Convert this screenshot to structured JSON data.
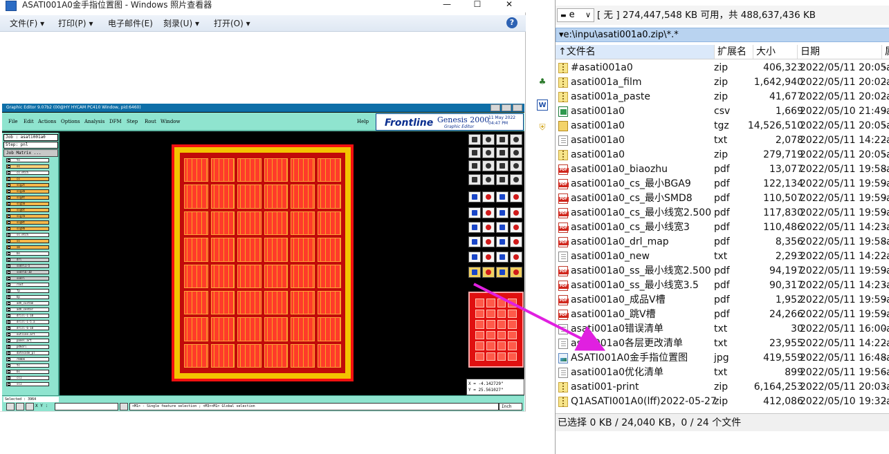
{
  "photo_viewer": {
    "title": "ASATI001A0金手指位置图 - Windows 照片查看器",
    "window_controls": {
      "minimize": "—",
      "maximize": "☐",
      "close": "✕"
    },
    "menu": [
      "文件(F)",
      "打印(P)",
      "电子邮件(E)",
      "刻录(U)",
      "打开(O)"
    ],
    "help_glyph": "?"
  },
  "genesis": {
    "title_bar": "Graphic Editor 9.07b2 (00@HY HYCAM PC410 Window, pid:6460)",
    "menu": [
      "File",
      "Edit",
      "Actions",
      "Options",
      "Analysis",
      "DFM",
      "Step",
      "Rout",
      "Window"
    ],
    "help": "Help",
    "logo_text": "Frontline",
    "product": "Genesis 2000",
    "subtitle": "Graphic Editor",
    "date": "11 May 2022",
    "time": "04:47 PM",
    "job": "Job : asati001a0",
    "step": "Step: pnl",
    "job_matrix": "Job Matrix ...",
    "layers": [
      {
        "name": "to",
        "color": "#ffffff"
      },
      {
        "name": "ss",
        "color": "#ffd37a"
      },
      {
        "name": "cs.etch",
        "color": "#ffffff"
      },
      {
        "name": "cs",
        "color": "#f5b84a"
      },
      {
        "name": "sig2t",
        "color": "#f5b84a"
      },
      {
        "name": "sig3b",
        "color": "#f5b84a"
      },
      {
        "name": "sig4t",
        "color": "#f5b84a"
      },
      {
        "name": "sig5b",
        "color": "#f5b84a"
      },
      {
        "name": "sig6t",
        "color": "#f5b84a"
      },
      {
        "name": "sig7b",
        "color": "#f5b84a"
      },
      {
        "name": "sig8t",
        "color": "#f5b84a"
      },
      {
        "name": "sig9b",
        "color": "#f5b84a"
      },
      {
        "name": "ss.etch",
        "color": "#ffffff"
      },
      {
        "name": "ss",
        "color": "#f5b84a"
      },
      {
        "name": "sm",
        "color": "#f5b84a"
      },
      {
        "name": "bo",
        "color": "#ffffff"
      },
      {
        "name": "drl",
        "color": "#d0d0d0"
      },
      {
        "name": "sodrl1-5",
        "color": "#d0d0d0"
      },
      {
        "name": "sodrl6-10",
        "color": "#d0d0d0"
      },
      {
        "name": "sodrl",
        "color": "#d0d0d0"
      },
      {
        "name": "rout",
        "color": "#ffffff"
      },
      {
        "name": "fp",
        "color": "#ffffff"
      },
      {
        "name": "bp",
        "color": "#ffffff"
      },
      {
        "name": "adh_custom",
        "color": "#ffffff"
      },
      {
        "name": "adh_center",
        "color": "#ffffff"
      },
      {
        "name": "drill-1-10",
        "color": "#ffffff"
      },
      {
        "name": "drill-1-5.a",
        "color": "#ffffff"
      },
      {
        "name": "drill-6-10",
        "color": "#ffffff"
      },
      {
        "name": "outline.art",
        "color": "#ffffff"
      },
      {
        "name": "panel.art",
        "color": "#ffffff"
      },
      {
        "name": "pdkdrl",
        "color": "#ffffff"
      },
      {
        "name": "datecode_pl",
        "color": "#ffffff"
      },
      {
        "name": "rmmbk",
        "color": "#ffffff"
      },
      {
        "name": "tc",
        "color": "#ffffff"
      },
      {
        "name": "bs",
        "color": "#ffffff"
      },
      {
        "name": "cs1",
        "color": "#ffffff"
      },
      {
        "name": "ss1",
        "color": "#ffffff"
      }
    ],
    "selected": "Selected : 3964",
    "xy_label": "X Y :",
    "message": "<M1> - Single feature selection ; <M3><M1> Global selection",
    "coord_x": "X = -4.142729\"",
    "coord_y": "Y = 25.561027\"",
    "unit": "Inch",
    "colors": {
      "teal": "#8fe4cf",
      "pcb_red": "#c10a0a",
      "pcb_yellow": "#f3c300"
    }
  },
  "file_manager": {
    "drive": "e",
    "drive_info": "[ 无 ]  274,447,548 KB 可用，共 488,637,436 KB",
    "path": "▾e:\\inpu\\asati001a0.zip\\*.*",
    "columns": {
      "name": "↑文件名",
      "ext": "扩展名",
      "size": "大小",
      "date": "日期",
      "attr": "属"
    },
    "files": [
      {
        "name": "#asati001a0",
        "ext": "zip",
        "size": "406,323",
        "date": "2022/05/11 20:05",
        "attr": "-a",
        "icon": "zip"
      },
      {
        "name": "asati001a_film",
        "ext": "zip",
        "size": "1,642,940",
        "date": "2022/05/11 20:02",
        "attr": "-a",
        "icon": "zip"
      },
      {
        "name": "asati001a_paste",
        "ext": "zip",
        "size": "41,677",
        "date": "2022/05/11 20:02",
        "attr": "-a",
        "icon": "zip"
      },
      {
        "name": "asati001a0",
        "ext": "csv",
        "size": "1,669",
        "date": "2022/05/10 21:49",
        "attr": "-a",
        "icon": "csv"
      },
      {
        "name": "asati001a0",
        "ext": "tgz",
        "size": "14,526,510",
        "date": "2022/05/11 20:05",
        "attr": "-a",
        "icon": "tgz"
      },
      {
        "name": "asati001a0",
        "ext": "txt",
        "size": "2,078",
        "date": "2022/05/11 14:22",
        "attr": "-a",
        "icon": "txt"
      },
      {
        "name": "asati001a0",
        "ext": "zip",
        "size": "279,719",
        "date": "2022/05/11 20:05",
        "attr": "-a",
        "icon": "zip"
      },
      {
        "name": "asati001a0_biaozhu",
        "ext": "pdf",
        "size": "13,077",
        "date": "2022/05/11 19:58",
        "attr": "-a",
        "icon": "pdf"
      },
      {
        "name": "asati001a0_cs_最小BGA9",
        "ext": "pdf",
        "size": "122,134",
        "date": "2022/05/11 19:59",
        "attr": "-a",
        "icon": "pdf"
      },
      {
        "name": "asati001a0_cs_最小SMD8",
        "ext": "pdf",
        "size": "110,507",
        "date": "2022/05/11 19:59",
        "attr": "-a",
        "icon": "pdf"
      },
      {
        "name": "asati001a0_cs_最小线宽2.500",
        "ext": "pdf",
        "size": "117,830",
        "date": "2022/05/11 19:59",
        "attr": "-a",
        "icon": "pdf"
      },
      {
        "name": "asati001a0_cs_最小线宽3",
        "ext": "pdf",
        "size": "110,486",
        "date": "2022/05/11 14:23",
        "attr": "-a",
        "icon": "pdf"
      },
      {
        "name": "asati001a0_drl_map",
        "ext": "pdf",
        "size": "8,356",
        "date": "2022/05/11 19:58",
        "attr": "-a",
        "icon": "pdf"
      },
      {
        "name": "asati001a0_new",
        "ext": "txt",
        "size": "2,293",
        "date": "2022/05/11 14:22",
        "attr": "-a",
        "icon": "txt"
      },
      {
        "name": "asati001a0_ss_最小线宽2.500",
        "ext": "pdf",
        "size": "94,197",
        "date": "2022/05/11 19:59",
        "attr": "-a",
        "icon": "pdf"
      },
      {
        "name": "asati001a0_ss_最小线宽3.5",
        "ext": "pdf",
        "size": "90,317",
        "date": "2022/05/11 14:23",
        "attr": "-a",
        "icon": "pdf"
      },
      {
        "name": "asati001a0_成品V槽",
        "ext": "pdf",
        "size": "1,952",
        "date": "2022/05/11 19:59",
        "attr": "-a",
        "icon": "pdf"
      },
      {
        "name": "asati001a0_跳V槽",
        "ext": "pdf",
        "size": "24,266",
        "date": "2022/05/11 19:59",
        "attr": "-a",
        "icon": "pdf"
      },
      {
        "name": "asati001a0错误清单",
        "ext": "txt",
        "size": "30",
        "date": "2022/05/11 16:00",
        "attr": "-a",
        "icon": "txt"
      },
      {
        "name": "asati001a0各层更改清单",
        "ext": "txt",
        "size": "23,955",
        "date": "2022/05/11 14:22",
        "attr": "-a",
        "icon": "txt"
      },
      {
        "name": "ASATI001A0金手指位置图",
        "ext": "jpg",
        "size": "419,559",
        "date": "2022/05/11 16:48",
        "attr": "-a",
        "icon": "jpg"
      },
      {
        "name": "asati001a0优化清单",
        "ext": "txt",
        "size": "899",
        "date": "2022/05/11 19:56",
        "attr": "-a",
        "icon": "txt"
      },
      {
        "name": "asati001-print",
        "ext": "zip",
        "size": "6,164,253",
        "date": "2022/05/11 20:03",
        "attr": "-a",
        "icon": "zip"
      },
      {
        "name": "Q1ASATI001A0(lff)2022-05-27",
        "ext": "zip",
        "size": "412,086",
        "date": "2022/05/10 19:32",
        "attr": "-a",
        "icon": "zip"
      }
    ],
    "status": "已选择 0 KB / 24,040 KB，0 / 24 个文件"
  },
  "side_strip_icons": [
    "network-tree-icon",
    "word-doc-icon",
    "shield-icon"
  ],
  "arrow_color": "#e020e0"
}
